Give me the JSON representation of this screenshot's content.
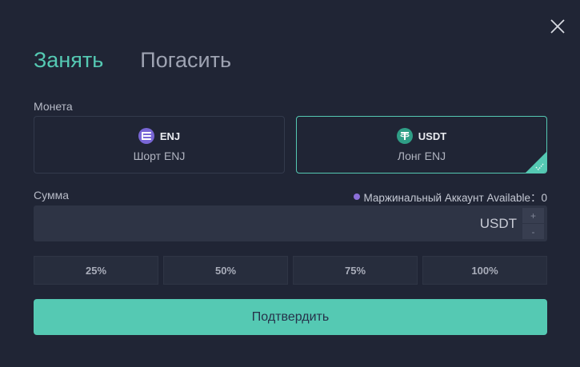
{
  "tabs": [
    {
      "label": "Занять",
      "active": true
    },
    {
      "label": "Погасить",
      "active": false
    }
  ],
  "coin_section": {
    "label": "Монета",
    "options": [
      {
        "symbol": "ENJ",
        "subtitle": "Шорт ENJ",
        "icon": "enj-coin-icon",
        "selected": false
      },
      {
        "symbol": "USDT",
        "subtitle": "Лонг ENJ",
        "icon": "usdt-coin-icon",
        "selected": true
      }
    ]
  },
  "amount": {
    "label": "Сумма",
    "available_text": "Маржинальный Аккаунт Available：0",
    "value": "",
    "unit": "USDT",
    "step_up": "+",
    "step_down": "-"
  },
  "percent_buttons": [
    "25%",
    "50%",
    "75%",
    "100%"
  ],
  "confirm_label": "Подтвердить",
  "colors": {
    "background": "#202535",
    "accent": "#55c9b3",
    "input_bg": "#2e3445",
    "enj": "#7866d5",
    "usdt": "#2f9e86"
  }
}
